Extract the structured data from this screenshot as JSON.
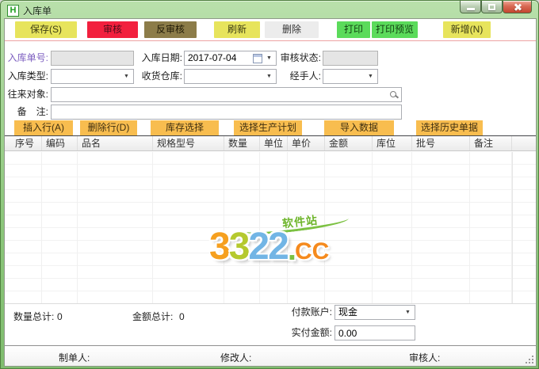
{
  "window": {
    "title": "入库单",
    "icon_letter": "H"
  },
  "colors": {
    "titlebar_green": "#8cc77b",
    "button_yellow": "#e7e45c",
    "button_red": "#f2203e",
    "button_olive": "#8c7c49",
    "button_gray": "#ececec",
    "button_green": "#5bdb5b",
    "button_orange": "#f8bd4f",
    "separator_pink": "#eda3a3",
    "label_purple": "#7d5fc0"
  },
  "toolbar": {
    "buttons": [
      {
        "label": "保存(S)",
        "style": "background:#e7e45c;color:#3c3c14"
      },
      {
        "label": "审核",
        "style": "background:#f2203e;color:#4d0e1a"
      },
      {
        "label": "反审核",
        "style": "background:#8c7c49;color:#201a07"
      },
      {
        "label": "刷新",
        "style": "background:#e7e45c;color:#3c3c14"
      },
      {
        "label": "删除",
        "style": "background:#ececec;color:#333333"
      },
      {
        "label": "打印",
        "style": "background:#5bdb5b;color:#123f12"
      },
      {
        "label": "打印预览",
        "style": "background:#5bdb5b;color:#123f12"
      },
      {
        "label": "新增(N)",
        "style": "background:#e7e45c;color:#3c3c14"
      }
    ]
  },
  "form": {
    "order_no": {
      "label": "入库单号:",
      "value": ""
    },
    "date": {
      "label": "入库日期:",
      "value": "2017-07-04"
    },
    "audit_status": {
      "label": "审核状态:",
      "value": ""
    },
    "type": {
      "label": "入库类型:",
      "value": ""
    },
    "warehouse": {
      "label": "收货仓库:",
      "value": ""
    },
    "handler": {
      "label": "经手人:",
      "value": ""
    },
    "counterparty": {
      "label": "往来对象:",
      "value": ""
    },
    "remark": {
      "label": "备　注:",
      "value": ""
    }
  },
  "row_actions": {
    "buttons": [
      "插入行(A)",
      "删除行(D)",
      "库存选择",
      "选择生产计划",
      "导入数据",
      "选择历史单据"
    ]
  },
  "table": {
    "columns": [
      "序号",
      "编码",
      "品名",
      "规格型号",
      "数量",
      "单位",
      "单价",
      "金额",
      "库位",
      "批号",
      "备注"
    ]
  },
  "watermark": {
    "chars": [
      {
        "t": "3",
        "style": "color:#f6a01f"
      },
      {
        "t": "3",
        "style": "color:#b5c92e"
      },
      {
        "t": "2",
        "style": "color:#72b5e5"
      },
      {
        "t": "2",
        "style": "color:#72b5e5"
      }
    ],
    "dot": {
      "t": ".",
      "style": "color:#7cc142"
    },
    "cc": {
      "t": "CC",
      "style": "color:#f58a1d"
    },
    "tag": "软件站"
  },
  "totals": {
    "qty_label": "数量总计:",
    "qty_value": "0",
    "amount_label": "金额总计:",
    "amount_value": "0"
  },
  "payment": {
    "account_label": "付款账户:",
    "account_value": "现金",
    "paid_label": "实付金额:",
    "paid_value": "0.00"
  },
  "footer": {
    "creator_label": "制单人:",
    "modifier_label": "修改人:",
    "auditor_label": "审核人:"
  }
}
